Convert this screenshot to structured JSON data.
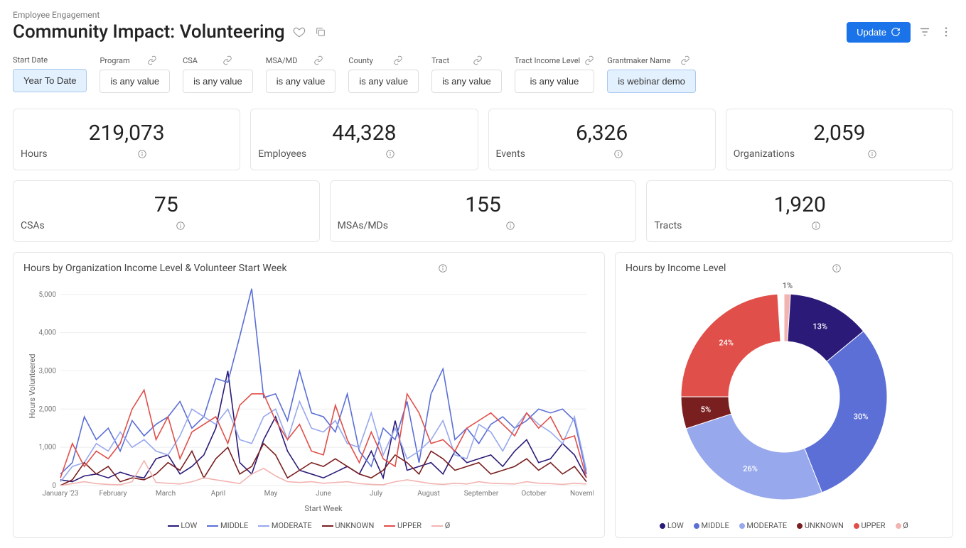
{
  "breadcrumb": "Employee Engagement",
  "title": "Community Impact: Volunteering",
  "update_label": "Update",
  "filters": [
    {
      "label": "Start Date",
      "value": "Year To Date",
      "active": true,
      "link": false
    },
    {
      "label": "Program",
      "value": "is any value",
      "active": false,
      "link": true
    },
    {
      "label": "CSA",
      "value": "is any value",
      "active": false,
      "link": true
    },
    {
      "label": "MSA/MD",
      "value": "is any value",
      "active": false,
      "link": true
    },
    {
      "label": "County",
      "value": "is any value",
      "active": false,
      "link": true
    },
    {
      "label": "Tract",
      "value": "is any value",
      "active": false,
      "link": true
    },
    {
      "label": "Tract Income Level",
      "value": "is any value",
      "active": false,
      "link": true
    },
    {
      "label": "Grantmaker Name",
      "value": "is webinar demo",
      "active": true,
      "link": true
    }
  ],
  "metrics_row1": [
    {
      "value": "219,073",
      "label": "Hours"
    },
    {
      "value": "44,328",
      "label": "Employees"
    },
    {
      "value": "6,326",
      "label": "Events"
    },
    {
      "value": "2,059",
      "label": "Organizations"
    }
  ],
  "metrics_row2": [
    {
      "value": "75",
      "label": "CSAs"
    },
    {
      "value": "155",
      "label": "MSAs/MDs"
    },
    {
      "value": "1,920",
      "label": "Tracts"
    }
  ],
  "chart_data": [
    {
      "id": "line",
      "type": "line",
      "title": "Hours by Organization Income Level & Volunteer Start Week",
      "xlabel": "Start Week",
      "ylabel": "Hours Volunteered",
      "ylim": [
        0,
        5200
      ],
      "yticks": [
        0,
        1000,
        2000,
        3000,
        4000,
        5000
      ],
      "xticks": [
        "January '23",
        "February",
        "March",
        "April",
        "May",
        "June",
        "July",
        "August",
        "September",
        "October",
        "November"
      ],
      "colors": {
        "LOW": "#2b1a78",
        "MIDDLE": "#5b6fd6",
        "MODERATE": "#97a8ed",
        "UNKNOWN": "#7a1f1f",
        "UPPER": "#e04f4a",
        "Ø": "#f2b4b1"
      },
      "series": [
        {
          "name": "LOW",
          "values": [
            150,
            100,
            250,
            300,
            200,
            350,
            250,
            200,
            700,
            800,
            300,
            500,
            800,
            1500,
            3000,
            600,
            300,
            1200,
            1800,
            900,
            400,
            300,
            200,
            350,
            500,
            300,
            900,
            200,
            1700,
            400,
            500,
            600,
            300,
            900,
            600,
            700,
            800,
            500,
            900,
            1200,
            600,
            700,
            1100,
            800,
            200
          ]
        },
        {
          "name": "MIDDLE",
          "values": [
            300,
            600,
            1800,
            1200,
            1500,
            900,
            1700,
            1300,
            1600,
            1800,
            2200,
            1500,
            1800,
            2800,
            2700,
            3900,
            5150,
            2300,
            2400,
            1700,
            3000,
            1900,
            1800,
            1400,
            2400,
            900,
            500,
            1500,
            1200,
            2200,
            600,
            2400,
            3050,
            1200,
            1500,
            1100,
            1600,
            1800,
            1500,
            1700,
            2000,
            1900,
            2000,
            1700,
            300
          ]
        },
        {
          "name": "MODERATE",
          "values": [
            100,
            500,
            600,
            1100,
            900,
            1400,
            1000,
            1200,
            900,
            800,
            1300,
            2000,
            1800,
            1600,
            2000,
            1200,
            1100,
            1800,
            2000,
            1200,
            2200,
            1500,
            1400,
            1700,
            1100,
            1000,
            1900,
            800,
            1500,
            700,
            900,
            1200,
            1700,
            800,
            700,
            1600,
            1400,
            900,
            1500,
            1900,
            1600,
            1400,
            1100,
            1800,
            400
          ]
        },
        {
          "name": "UNKNOWN",
          "values": [
            0,
            150,
            600,
            300,
            500,
            100,
            200,
            150,
            300,
            600,
            400,
            900,
            200,
            700,
            1000,
            300,
            500,
            1100,
            800,
            200,
            400,
            600,
            500,
            700,
            500,
            300,
            200,
            400,
            800,
            600,
            300,
            900,
            700,
            400,
            500,
            600,
            300,
            400,
            500,
            700,
            400,
            600,
            300,
            500,
            100
          ]
        },
        {
          "name": "UPPER",
          "values": [
            200,
            1100,
            500,
            900,
            700,
            1100,
            2000,
            2500,
            1200,
            1800,
            700,
            1400,
            1600,
            1800,
            1100,
            2100,
            2400,
            2400,
            1700,
            1200,
            1600,
            900,
            800,
            2100,
            1200,
            600,
            1400,
            700,
            500,
            2400,
            1900,
            1100,
            1200,
            900,
            1500,
            1700,
            1900,
            1600,
            1300,
            1900,
            1500,
            1800,
            1200,
            1300,
            200
          ]
        },
        {
          "name": "Ø",
          "values": [
            0,
            50,
            100,
            50,
            30,
            20,
            100,
            650,
            80,
            60,
            40,
            100,
            200,
            150,
            100,
            50,
            300,
            450,
            250,
            100,
            80,
            100,
            60,
            80,
            100,
            50,
            30,
            20,
            100,
            150,
            100,
            50,
            30,
            60,
            40,
            100,
            60,
            50,
            40,
            100,
            60,
            50,
            30,
            60,
            40
          ]
        }
      ]
    },
    {
      "id": "donut",
      "type": "pie",
      "title": "Hours by Income Level",
      "slices": [
        {
          "name": "LOW",
          "pct": 13,
          "color": "#2b1a78"
        },
        {
          "name": "MIDDLE",
          "pct": 30,
          "color": "#5b6fd6"
        },
        {
          "name": "MODERATE",
          "pct": 26,
          "color": "#97a8ed"
        },
        {
          "name": "UNKNOWN",
          "pct": 5,
          "color": "#7a1f1f"
        },
        {
          "name": "UPPER",
          "pct": 24,
          "color": "#e04f4a"
        },
        {
          "name": "Ø",
          "pct": 1,
          "color": "#f2b4b1"
        }
      ]
    }
  ]
}
